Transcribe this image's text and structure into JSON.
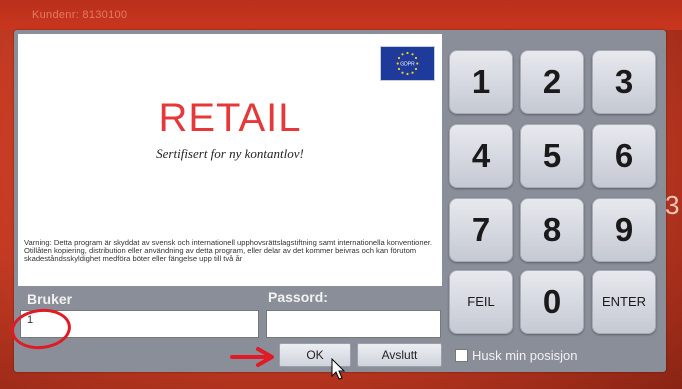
{
  "topbar": {
    "text": "Kundenr: 8130100"
  },
  "brand": {
    "title": "RETAIL",
    "subtitle": "Sertifisert for ny kontantlov!",
    "badge_text": "GDPR"
  },
  "warning": "Varning: Detta program är skyddat av svensk och internationell upphovsrättslagstiftning samt internationella konventioner. Otillåten kopiering, distribution eller användning av detta program, eller delar av det kommer beivras och kan förutom skadeståndsskyldighet medföra böter eller fängelse upp till två år",
  "login": {
    "user_label": "Bruker",
    "user_value": "1",
    "password_label": "Passord:",
    "password_value": "",
    "ok_label": "OK",
    "exit_label": "Avslutt",
    "remember_label": "Husk min posisjon",
    "remember_checked": false
  },
  "keypad": {
    "keys": [
      "1",
      "2",
      "3",
      "4",
      "5",
      "6",
      "7",
      "8",
      "9",
      "FEIL",
      "0",
      "ENTER"
    ]
  },
  "edge_text": "3",
  "colors": {
    "background": "#c8331f",
    "accent": "#e4383a",
    "annotation": "#e11b25",
    "panel": "#8a8e99"
  }
}
